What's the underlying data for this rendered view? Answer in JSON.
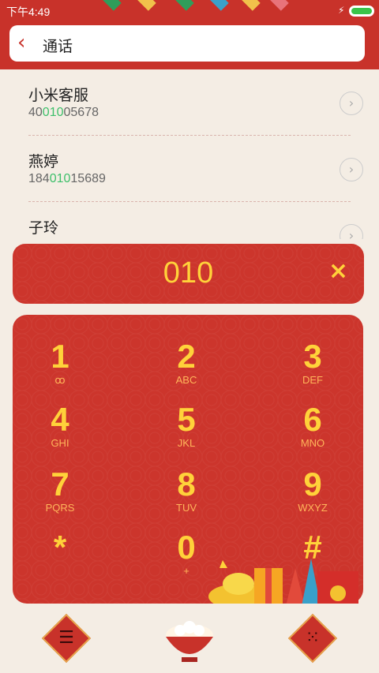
{
  "status": {
    "time": "下午4:49",
    "charging_icon": "lightning-icon",
    "battery_level": 1.0
  },
  "header": {
    "back_icon": "chevron-left-icon",
    "title": "通话"
  },
  "results": [
    {
      "name": "小米客服",
      "number_pre": "40",
      "number_hl": "010",
      "number_post": "05678"
    },
    {
      "name": "燕婷",
      "number_pre": "184",
      "number_hl": "010",
      "number_post": "15689"
    },
    {
      "name": "子玲",
      "number_pre": "",
      "number_hl": "",
      "number_post": ""
    }
  ],
  "dial": {
    "value": "010",
    "clear_label": "×"
  },
  "keypad": [
    {
      "digit": "1",
      "letters": "ꝏ"
    },
    {
      "digit": "2",
      "letters": "ABC"
    },
    {
      "digit": "3",
      "letters": "DEF"
    },
    {
      "digit": "4",
      "letters": "GHI"
    },
    {
      "digit": "5",
      "letters": "JKL"
    },
    {
      "digit": "6",
      "letters": "MNO"
    },
    {
      "digit": "7",
      "letters": "PQRS"
    },
    {
      "digit": "8",
      "letters": "TUV"
    },
    {
      "digit": "9",
      "letters": "WXYZ"
    },
    {
      "digit": "*",
      "letters": ""
    },
    {
      "digit": "0",
      "letters": "+"
    },
    {
      "digit": "#",
      "letters": ""
    }
  ],
  "bottom": {
    "menu_icon": "menu-icon",
    "call_icon": "rice-bowl-icon",
    "dialpad_icon": "dialpad-icon"
  },
  "colors": {
    "accent": "#c8322a",
    "digits": "#ffd23a",
    "highlight": "#3dbf6a"
  }
}
